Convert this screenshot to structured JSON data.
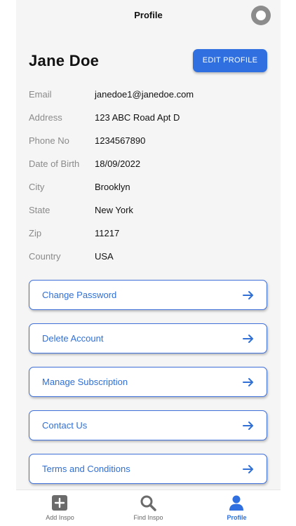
{
  "header": {
    "title": "Profile"
  },
  "profile": {
    "name": "Jane Doe",
    "edit_label": "EDIT PROFILE"
  },
  "info": [
    {
      "label": "Email",
      "value": "janedoe1@janedoe.com"
    },
    {
      "label": "Address",
      "value": "123 ABC Road Apt D"
    },
    {
      "label": "Phone No",
      "value": "1234567890"
    },
    {
      "label": "Date of Birth",
      "value": "18/09/2022"
    },
    {
      "label": "City",
      "value": "Brooklyn"
    },
    {
      "label": "State",
      "value": "New York"
    },
    {
      "label": "Zip",
      "value": "11217"
    },
    {
      "label": "Country",
      "value": "USA"
    }
  ],
  "menu": [
    {
      "label": "Change Password",
      "icon": "arrow-right-icon"
    },
    {
      "label": "Delete Account",
      "icon": "arrow-right-icon"
    },
    {
      "label": "Manage Subscription",
      "icon": "arrow-right-icon"
    },
    {
      "label": "Contact Us",
      "icon": "arrow-right-icon"
    },
    {
      "label": "Terms and Conditions",
      "icon": "arrow-right-icon"
    }
  ],
  "tabs": [
    {
      "label": "Add Inspo",
      "icon": "plus-square-icon",
      "active": false
    },
    {
      "label": "Find Inspo",
      "icon": "search-icon",
      "active": false
    },
    {
      "label": "Profile",
      "icon": "user-icon",
      "active": true
    }
  ],
  "colors": {
    "accent": "#2f6fe0",
    "background": "#f5f5f5",
    "label_gray": "#8a8a8a"
  }
}
